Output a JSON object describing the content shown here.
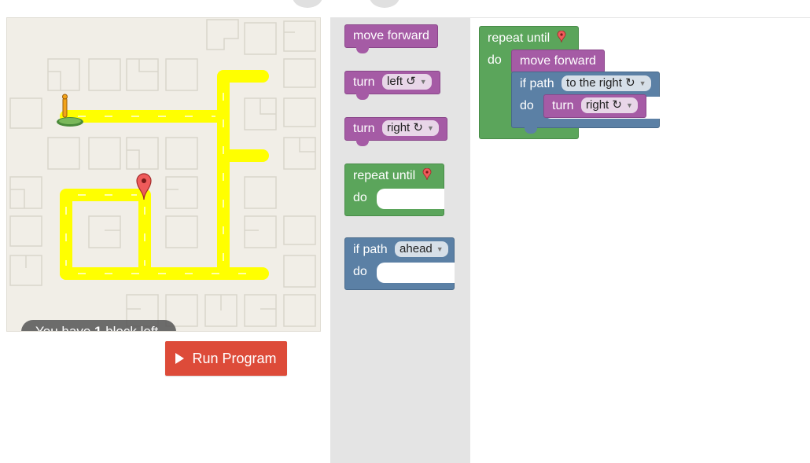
{
  "status": {
    "prefix": "You have ",
    "count": "1",
    "suffix": " block left."
  },
  "run_button": {
    "label": "Run Program"
  },
  "toolbox": {
    "move_forward": "move forward",
    "turn_left": {
      "keyword": "turn",
      "value": "left ↺"
    },
    "turn_right": {
      "keyword": "turn",
      "value": "right ↻"
    },
    "repeat_until": {
      "label": "repeat until",
      "do": "do"
    },
    "if_path": {
      "keyword": "if path",
      "value": "ahead",
      "do": "do"
    }
  },
  "workspace": {
    "repeat_until": {
      "label": "repeat until",
      "do": "do"
    },
    "move_forward": "move forward",
    "if_path": {
      "keyword": "if path",
      "value": "to the right ↻",
      "do": "do"
    },
    "turn": {
      "keyword": "turn",
      "value": "right ↻"
    }
  },
  "colors": {
    "path": "#ffff00",
    "motion_block": "#a55ba5",
    "loop_block": "#5ba55b",
    "logic_block": "#5b80a5",
    "run_button": "#dd4b39",
    "goal_marker": "#ef5b5b"
  },
  "icons": {
    "pegman": "pegman-icon",
    "goal": "map-marker-icon",
    "dropdown": "dropdown-arrow-icon"
  }
}
